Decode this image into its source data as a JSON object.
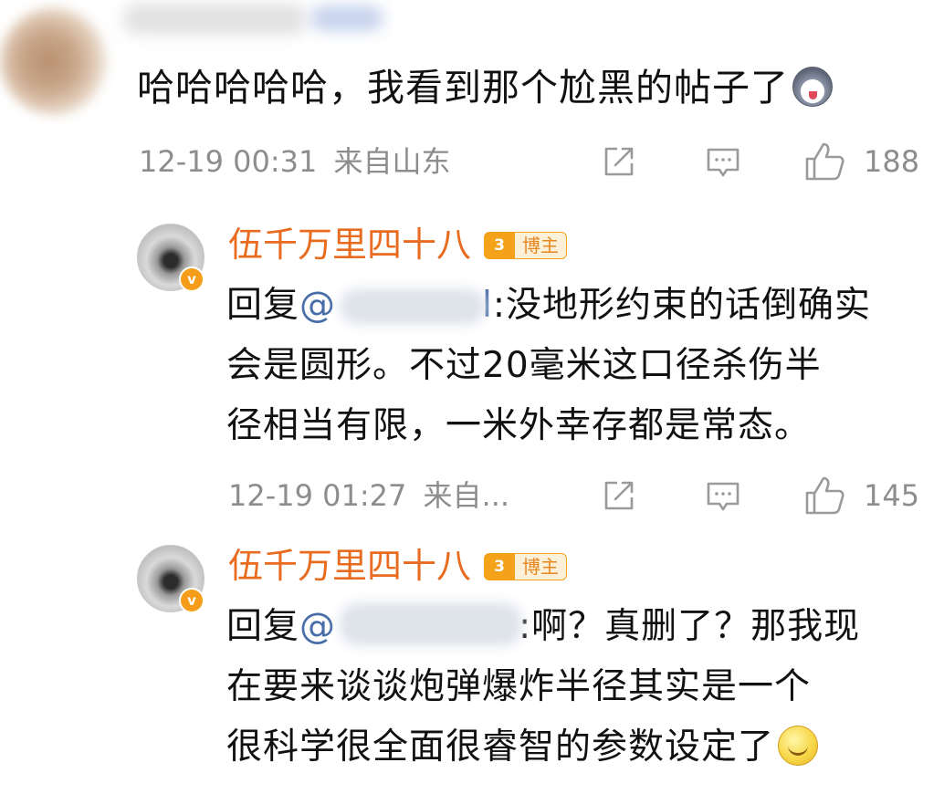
{
  "comment": {
    "text": "哈哈哈哈哈，我看到那个尬黑的帖子了",
    "emoji": "husky-emoji",
    "timestamp": "12-19 00:31",
    "location": "来自山东",
    "likes": "188"
  },
  "replies": [
    {
      "author": "伍千万里四十八",
      "badge": "博主",
      "reply_prefix": "回复",
      "at": "@",
      "line1_rest": ":没地形约束的话倒确实",
      "line2": "会是圆形。不过20毫米这口径杀伤半",
      "line3": "径相当有限，一米外幸存都是常态。",
      "timestamp": "12-19 01:27",
      "location": "来自...",
      "likes": "145"
    },
    {
      "author": "伍千万里四十八",
      "badge": "博主",
      "reply_prefix": "回复",
      "at": "@",
      "line1_rest": ":啊？真删了？那我现",
      "line2": "在要来谈谈炮弹爆炸半径其实是一个",
      "line3": "很科学很全面很睿智的参数设定了",
      "emoji": "smile-emoji"
    }
  ],
  "colors": {
    "author": "#e86b1f",
    "meta": "#8d8d8d",
    "mention": "#496ea8",
    "badge": "#f4a21a"
  },
  "icons": [
    "share-icon",
    "comment-icon",
    "like-icon"
  ]
}
